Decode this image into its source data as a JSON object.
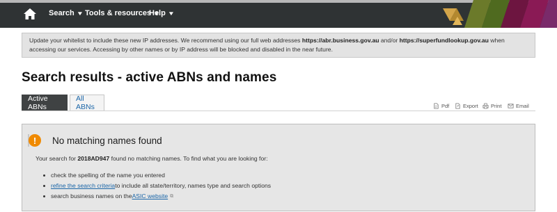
{
  "nav": {
    "search": "Search",
    "tools": "Tools & resources",
    "help": "Help"
  },
  "notice": {
    "text_1": "Update your whitelist to include these new IP addresses. We recommend using our full web addresses ",
    "url_1": "https://abr.business.gov.au",
    "text_2": " and/or ",
    "url_2": "https://superfundlookup.gov.au",
    "text_3": " when accessing our services. Accessing by other names or by IP address will be blocked and disabled in the near future."
  },
  "page": {
    "title": "Search results - active ABNs and names"
  },
  "tabs": [
    {
      "label": "Active ABNs",
      "active": true
    },
    {
      "label": "All ABNs",
      "active": false
    }
  ],
  "toolbar": {
    "pdf": "Pdf",
    "export": "Export",
    "print": "Print",
    "email": "Email"
  },
  "result": {
    "title": "No matching names found",
    "text_before": "Your search for ",
    "query": "2018AD947",
    "text_after": " found no matching names. To find what you are looking for:",
    "bullet_1": "check the spelling of the name you entered",
    "bullet_2_link": "refine the search criteria",
    "bullet_2_text": " to include all state/territory, names type and search options",
    "bullet_3_text": "search business names on the ",
    "bullet_3_link": "ASIC website"
  },
  "colors": {
    "nav_bg": "#2f3334",
    "accent_orange": "#f08a00",
    "link": "#1b66a8",
    "tab_active": "#3f4243"
  }
}
